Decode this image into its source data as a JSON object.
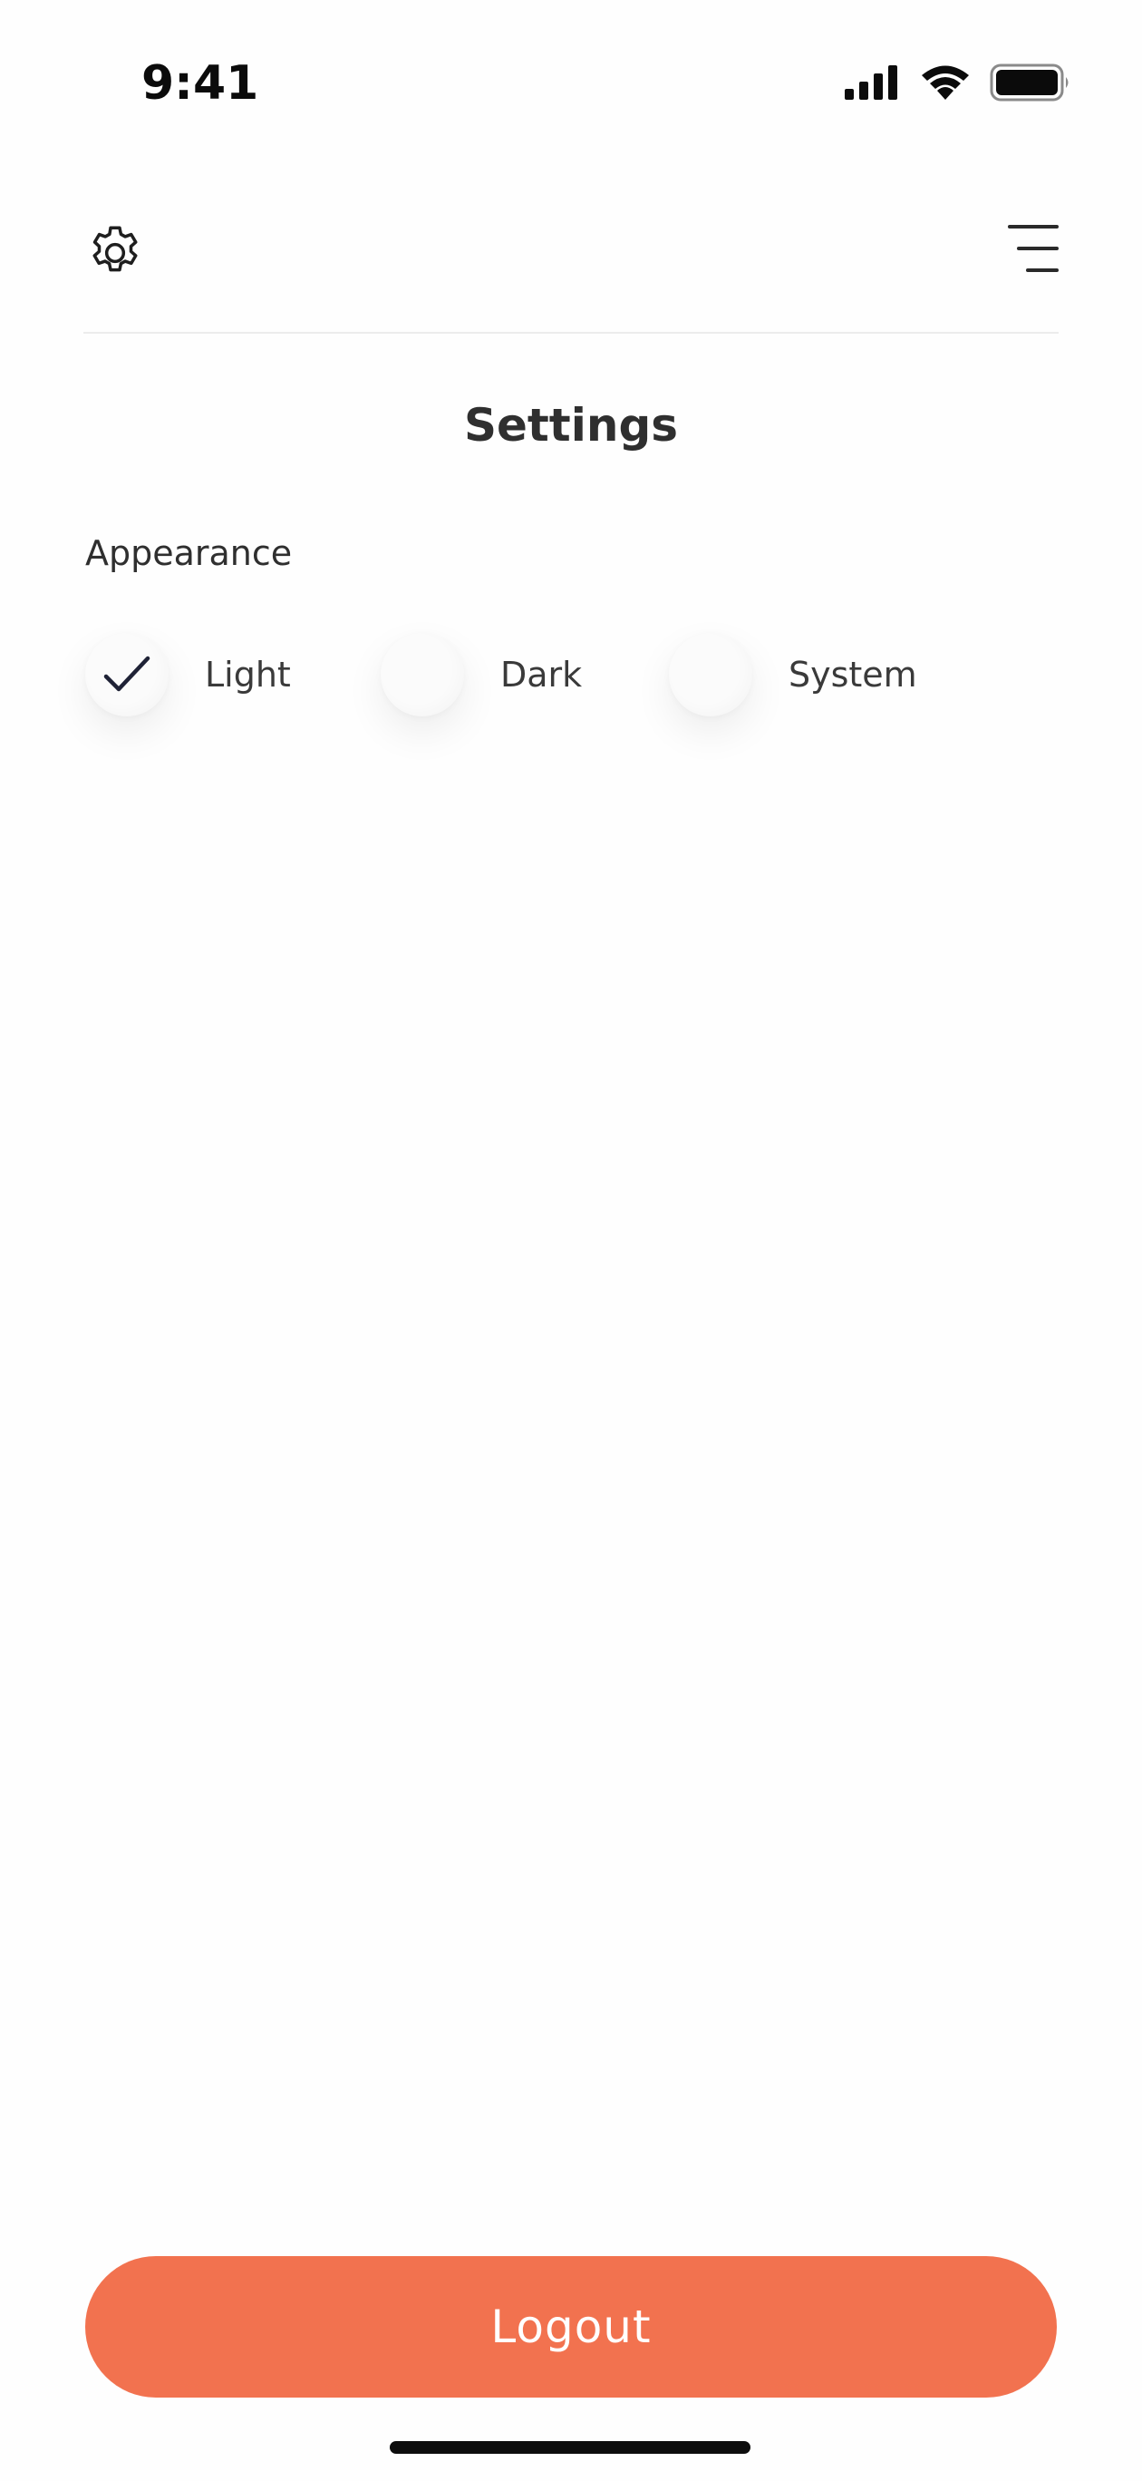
{
  "status_bar": {
    "time": "9:41",
    "icons": [
      "cellular-signal-icon",
      "wifi-icon",
      "battery-icon"
    ]
  },
  "header": {
    "left_icon": "gear-icon",
    "right_icon": "menu-icon"
  },
  "page": {
    "title": "Settings"
  },
  "appearance": {
    "label": "Appearance",
    "options": [
      {
        "label": "Light",
        "selected": true
      },
      {
        "label": "Dark",
        "selected": false
      },
      {
        "label": "System",
        "selected": false
      }
    ]
  },
  "footer": {
    "logout_label": "Logout"
  },
  "colors": {
    "accent": "#f2724f",
    "background": "#fefefe",
    "text": "#2f2f2f",
    "check": "#1f2236"
  }
}
